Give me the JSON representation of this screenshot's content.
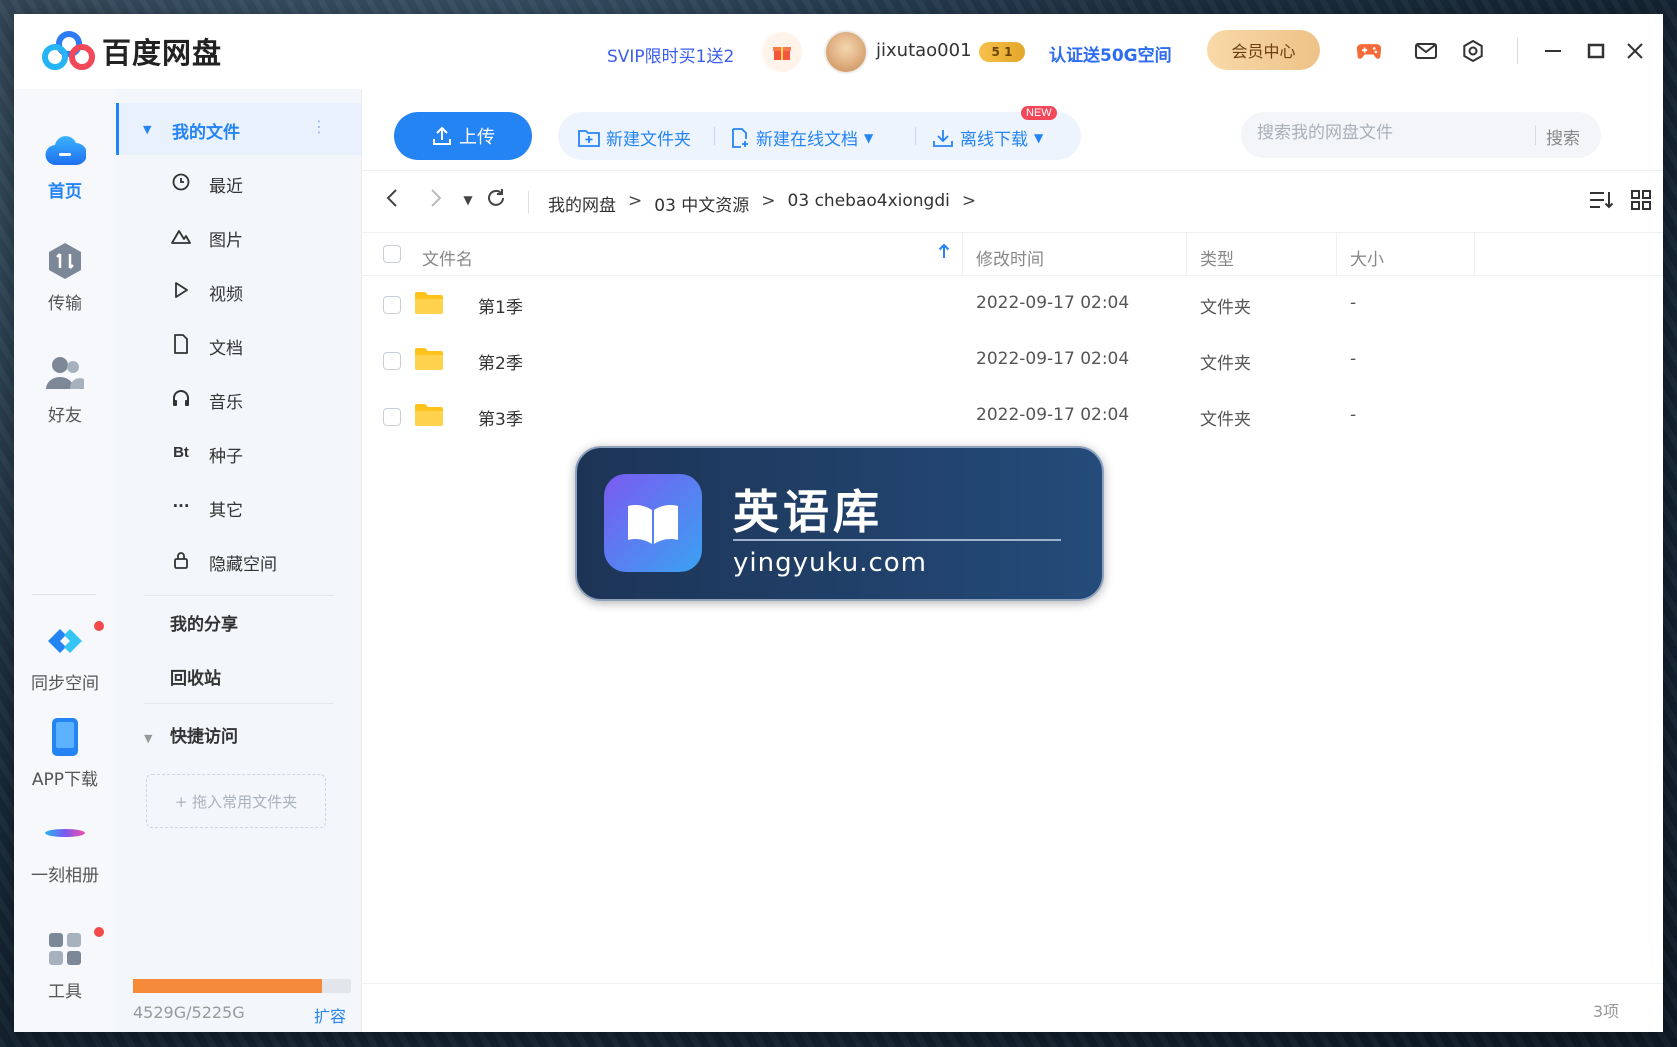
{
  "app": {
    "title": "百度网盘"
  },
  "titlebar": {
    "promo": "SVIP限时买1送2",
    "username": "jixutao001",
    "vip_badge": "5 1",
    "cert_promo": "认证送50G空间",
    "member_center": "会员中心"
  },
  "iconbar": {
    "items": [
      {
        "label": "首页",
        "icon": "cloud-icon",
        "active": true
      },
      {
        "label": "传输",
        "icon": "transfer-icon"
      },
      {
        "label": "好友",
        "icon": "friends-icon"
      },
      {
        "label": "同步空间",
        "icon": "sync-icon"
      },
      {
        "label": "APP下载",
        "icon": "phone-icon"
      },
      {
        "label": "一刻相册",
        "icon": "album-icon"
      },
      {
        "label": "工具",
        "icon": "tools-icon"
      }
    ]
  },
  "sidebar": {
    "my_files": "我的文件",
    "items": [
      {
        "label": "最近",
        "icon": "clock-icon"
      },
      {
        "label": "图片",
        "icon": "mountain-icon"
      },
      {
        "label": "视频",
        "icon": "play-icon"
      },
      {
        "label": "文档",
        "icon": "document-icon"
      },
      {
        "label": "音乐",
        "icon": "headphones-icon"
      },
      {
        "label": "种子",
        "icon": "bt-icon",
        "glyph": "Bt"
      },
      {
        "label": "其它",
        "icon": "more-icon",
        "glyph": "···"
      },
      {
        "label": "隐藏空间",
        "icon": "lock-icon"
      }
    ],
    "my_share": "我的分享",
    "recycle_bin": "回收站",
    "quick_access": "快捷访问",
    "drop_hint": "+ 拖入常用文件夹",
    "storage": {
      "used_total": "4529G/5225G",
      "fill_fraction": 0.867,
      "expand": "扩容"
    }
  },
  "toolbar": {
    "upload": "上传",
    "new_folder": "新建文件夹",
    "new_online_doc": "新建在线文档",
    "new_badge": "NEW",
    "offline_download": "离线下载",
    "search_placeholder": "搜索我的网盘文件",
    "search_button": "搜索"
  },
  "breadcrumb": {
    "items": [
      "我的网盘",
      "03 中文资源",
      "03 chebao4xiongdi"
    ],
    "separator": ">"
  },
  "table": {
    "columns": [
      "文件名",
      "修改时间",
      "类型",
      "大小"
    ],
    "rows": [
      {
        "name": "第1季",
        "modified": "2022-09-17 02:04",
        "type": "文件夹",
        "size": "-"
      },
      {
        "name": "第2季",
        "modified": "2022-09-17 02:04",
        "type": "文件夹",
        "size": "-"
      },
      {
        "name": "第3季",
        "modified": "2022-09-17 02:04",
        "type": "文件夹",
        "size": "-"
      }
    ]
  },
  "footer": {
    "item_count": "3项"
  },
  "watermark": {
    "title": "英语库",
    "url": "yingyuku.com"
  },
  "colors": {
    "accent": "#2584f3",
    "storage_fill": "#f58a3a",
    "folder": "#ffc21a"
  }
}
